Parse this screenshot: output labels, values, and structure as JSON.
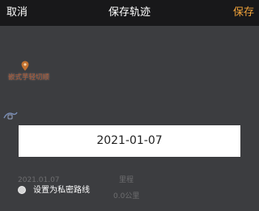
{
  "header": {
    "cancel_label": "取消",
    "title": "保存轨迹",
    "save_label": "保存"
  },
  "map": {
    "poi_label": "嵌式芋轻切顺"
  },
  "dialog": {
    "date": "2021-01-07"
  },
  "stats": {
    "date": "2021.01.07",
    "label": "里程",
    "distance": "0.0公里"
  },
  "privacy": {
    "label": "设置为私密路线",
    "checked": false
  },
  "colors": {
    "header_bg": "#18181a",
    "accent": "#f2a33a",
    "overlay_bg": "#3c3d40"
  }
}
